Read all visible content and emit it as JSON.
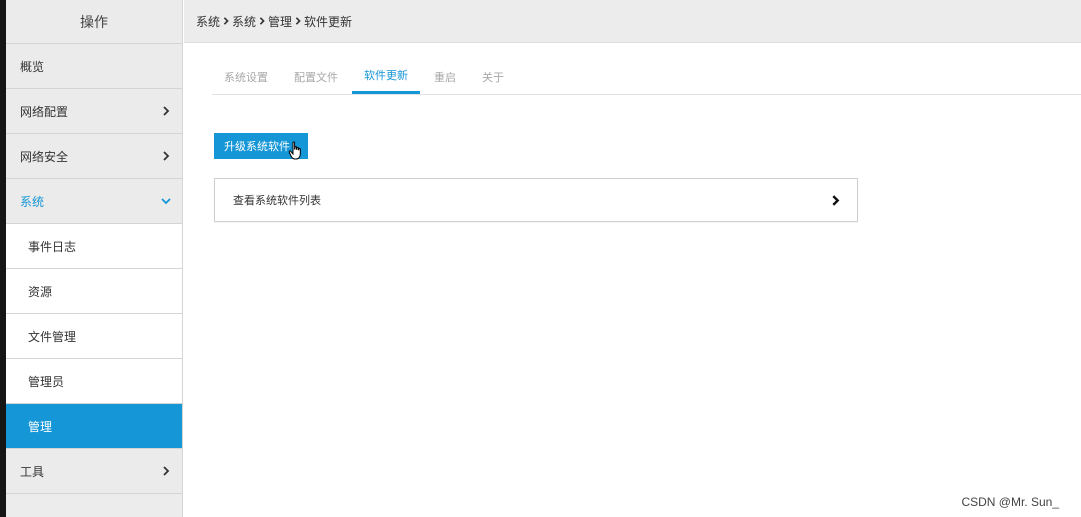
{
  "sidebar": {
    "header": "操作",
    "items": [
      {
        "label": "概览"
      },
      {
        "label": "网络配置"
      },
      {
        "label": "网络安全"
      },
      {
        "label": "系统"
      },
      {
        "label": "事件日志"
      },
      {
        "label": "资源"
      },
      {
        "label": "文件管理"
      },
      {
        "label": "管理员"
      },
      {
        "label": "管理"
      },
      {
        "label": "工具"
      }
    ]
  },
  "breadcrumb": [
    "系统",
    "系统",
    "管理",
    "软件更新"
  ],
  "tabs": [
    "系统设置",
    "配置文件",
    "软件更新",
    "重启",
    "关于"
  ],
  "main": {
    "upgrade_button": "升级系统软件",
    "list_item": "查看系统软件列表"
  },
  "watermark": "CSDN @Mr. Sun_",
  "colors": {
    "accent": "#1596d6",
    "sidebar_bg": "#ececec"
  },
  "active_tab": "软件更新",
  "active_nav": "管理"
}
